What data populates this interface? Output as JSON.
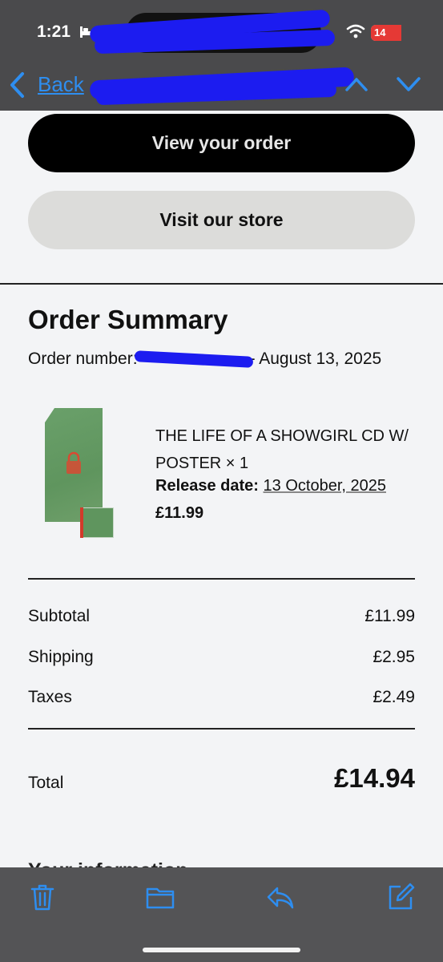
{
  "status_bar": {
    "time": "1:21",
    "battery_level": "14"
  },
  "nav": {
    "back_label": "Back"
  },
  "buttons": {
    "view_order": "View your order",
    "visit_store": "Visit our store"
  },
  "order_summary": {
    "title": "Order Summary",
    "order_number_prefix": "Order number:",
    "order_number_suffix": "- August 13, 2025",
    "item": {
      "name": "THE LIFE OF A SHOWGIRL CD W/ POSTER × 1",
      "release_label": "Release date:",
      "release_date": "13 October, 2025",
      "price": "£11.99"
    },
    "subtotal_label": "Subtotal",
    "subtotal_value": "£11.99",
    "shipping_label": "Shipping",
    "shipping_value": "£2.95",
    "taxes_label": "Taxes",
    "taxes_value": "£2.49",
    "total_label": "Total",
    "total_value": "£14.94"
  },
  "next_section_heading": "Your information",
  "colors": {
    "accent": "#2e8ef0",
    "redaction": "#1c1cf0",
    "battery_low": "#e53935"
  },
  "icons": {
    "status": [
      "bed-icon",
      "wifi-icon",
      "battery-icon"
    ],
    "nav": [
      "chevron-left-icon",
      "chevron-up-icon",
      "chevron-down-icon"
    ],
    "toolbar": [
      "trash-icon",
      "folder-icon",
      "reply-icon",
      "compose-icon"
    ]
  }
}
